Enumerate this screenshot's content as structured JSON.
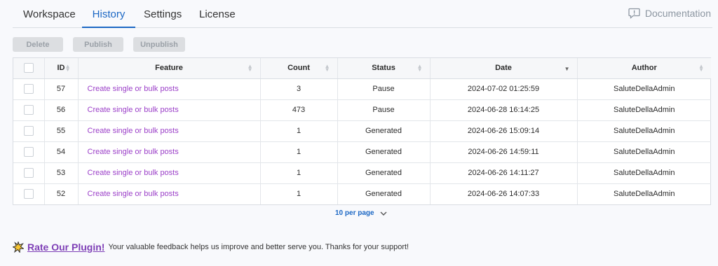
{
  "tabs": [
    {
      "label": "Workspace"
    },
    {
      "label": "History"
    },
    {
      "label": "Settings"
    },
    {
      "label": "License"
    }
  ],
  "documentation": {
    "label": "Documentation",
    "icon": "comment-alert-icon"
  },
  "actions": {
    "delete": "Delete",
    "publish": "Publish",
    "unpublish": "Unpublish"
  },
  "table": {
    "columns": [
      "ID",
      "Feature",
      "Count",
      "Status",
      "Date",
      "Author"
    ],
    "rows": [
      {
        "id": "57",
        "feature": "Create single or bulk posts",
        "count": "3",
        "status": "Pause",
        "date": "2024-07-02 01:25:59",
        "author": "SaluteDellaAdmin"
      },
      {
        "id": "56",
        "feature": "Create single or bulk posts",
        "count": "473",
        "status": "Pause",
        "date": "2024-06-28 16:14:25",
        "author": "SaluteDellaAdmin"
      },
      {
        "id": "55",
        "feature": "Create single or bulk posts",
        "count": "1",
        "status": "Generated",
        "date": "2024-06-26 15:09:14",
        "author": "SaluteDellaAdmin"
      },
      {
        "id": "54",
        "feature": "Create single or bulk posts",
        "count": "1",
        "status": "Generated",
        "date": "2024-06-26 14:59:11",
        "author": "SaluteDellaAdmin"
      },
      {
        "id": "53",
        "feature": "Create single or bulk posts",
        "count": "1",
        "status": "Generated",
        "date": "2024-06-26 14:11:27",
        "author": "SaluteDellaAdmin"
      },
      {
        "id": "52",
        "feature": "Create single or bulk posts",
        "count": "1",
        "status": "Generated",
        "date": "2024-06-26 14:07:33",
        "author": "SaluteDellaAdmin"
      }
    ]
  },
  "pagination": {
    "per_page": "10 per page"
  },
  "rate": {
    "link": "Rate Our Plugin!",
    "message": "Your valuable feedback helps us improve and better serve you. Thanks for your support!"
  },
  "colors": {
    "accent": "#1b67c4",
    "feature_link": "#9b3fc8",
    "rate_link": "#7e3fb6"
  }
}
